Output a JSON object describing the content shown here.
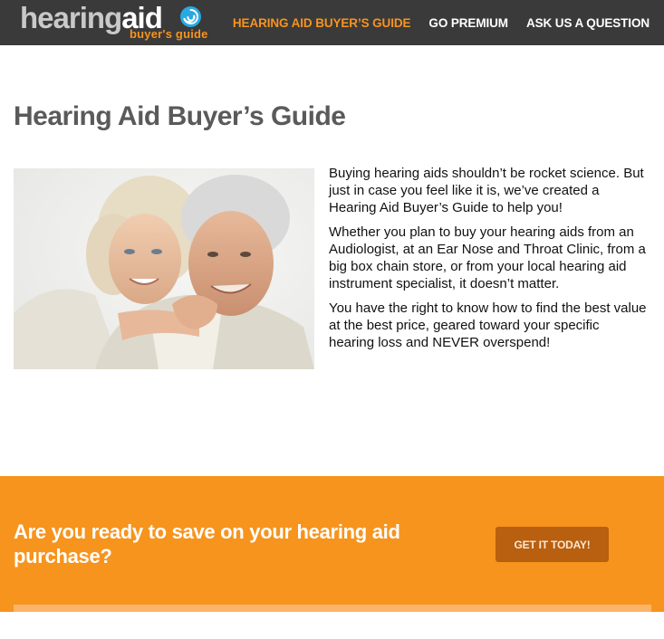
{
  "header": {
    "logo": {
      "word_part1": "hearing",
      "word_part2": "aid",
      "subtitle": "buyer's guide"
    },
    "nav": [
      {
        "label": "HEARING AID BUYER’S GUIDE",
        "active": true
      },
      {
        "label": "GO PREMIUM",
        "active": false
      },
      {
        "label": "ASK US A QUESTION",
        "active": false
      }
    ]
  },
  "main": {
    "title": "Hearing Aid Buyer’s Guide",
    "paragraphs": [
      "Buying hearing aids shouldn’t be rocket science. But just in case you feel like it is, we’ve created a Hearing Aid Buyer’s Guide to help you!",
      "Whether you plan to buy your hearing aids from an Audiologist, at an Ear Nose and Throat Clinic, from a big box chain store, or from your local hearing aid instrument specialist, it doesn’t matter.",
      "You have the right to know how to find the best value at the best price, geared toward your specific hearing loss and NEVER overspend!"
    ]
  },
  "cta": {
    "text": "Are you ready to save on your hearing aid purchase?",
    "button_label": "GET IT TODAY!"
  },
  "colors": {
    "header_bg": "#3a3a3a",
    "accent_orange": "#f7941d",
    "button_bg": "#b85f10",
    "title_gray": "#5a5a5a",
    "logo_blue": "#29a9e0"
  },
  "icons": {
    "logo_mark": "swirl-icon"
  }
}
